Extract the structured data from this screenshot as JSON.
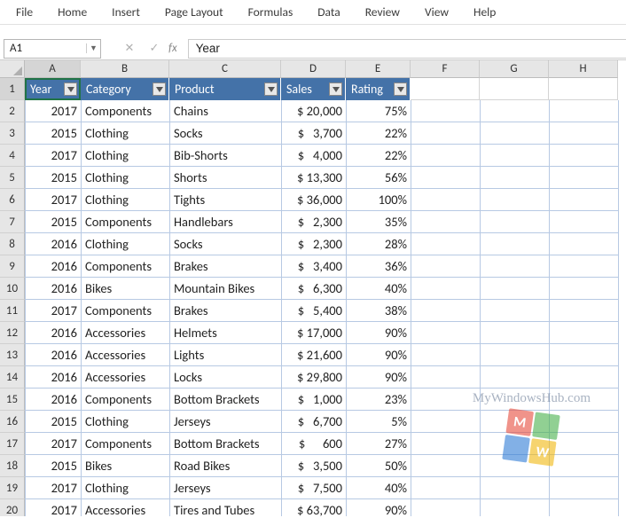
{
  "ribbon": [
    "File",
    "Home",
    "Insert",
    "Page Layout",
    "Formulas",
    "Data",
    "Review",
    "View",
    "Help"
  ],
  "namebox": "A1",
  "formula_value": "Year",
  "fx_label": "fx",
  "col_letters": [
    "A",
    "B",
    "C",
    "D",
    "E",
    "F",
    "G",
    "H"
  ],
  "row_count": 20,
  "table": {
    "headers": [
      "Year",
      "Category",
      "Product",
      "Sales",
      "Rating"
    ],
    "rows": [
      {
        "year": "2017",
        "category": "Components",
        "product": "Chains",
        "sales": "$ 20,000",
        "rating": "75%"
      },
      {
        "year": "2015",
        "category": "Clothing",
        "product": "Socks",
        "sales": "$   3,700",
        "rating": "22%"
      },
      {
        "year": "2017",
        "category": "Clothing",
        "product": "Bib-Shorts",
        "sales": "$   4,000",
        "rating": "22%"
      },
      {
        "year": "2015",
        "category": "Clothing",
        "product": "Shorts",
        "sales": "$ 13,300",
        "rating": "56%"
      },
      {
        "year": "2017",
        "category": "Clothing",
        "product": "Tights",
        "sales": "$ 36,000",
        "rating": "100%"
      },
      {
        "year": "2015",
        "category": "Components",
        "product": "Handlebars",
        "sales": "$   2,300",
        "rating": "35%"
      },
      {
        "year": "2016",
        "category": "Clothing",
        "product": "Socks",
        "sales": "$   2,300",
        "rating": "28%"
      },
      {
        "year": "2016",
        "category": "Components",
        "product": "Brakes",
        "sales": "$   3,400",
        "rating": "36%"
      },
      {
        "year": "2016",
        "category": "Bikes",
        "product": "Mountain Bikes",
        "sales": "$   6,300",
        "rating": "40%"
      },
      {
        "year": "2017",
        "category": "Components",
        "product": "Brakes",
        "sales": "$   5,400",
        "rating": "38%"
      },
      {
        "year": "2016",
        "category": "Accessories",
        "product": "Helmets",
        "sales": "$ 17,000",
        "rating": "90%"
      },
      {
        "year": "2016",
        "category": "Accessories",
        "product": "Lights",
        "sales": "$ 21,600",
        "rating": "90%"
      },
      {
        "year": "2016",
        "category": "Accessories",
        "product": "Locks",
        "sales": "$ 29,800",
        "rating": "90%"
      },
      {
        "year": "2016",
        "category": "Components",
        "product": "Bottom Brackets",
        "sales": "$   1,000",
        "rating": "23%"
      },
      {
        "year": "2015",
        "category": "Clothing",
        "product": "Jerseys",
        "sales": "$   6,700",
        "rating": "5%"
      },
      {
        "year": "2017",
        "category": "Components",
        "product": "Bottom Brackets",
        "sales": "$      600",
        "rating": "27%"
      },
      {
        "year": "2015",
        "category": "Bikes",
        "product": "Road Bikes",
        "sales": "$   3,500",
        "rating": "50%"
      },
      {
        "year": "2017",
        "category": "Clothing",
        "product": "Jerseys",
        "sales": "$   7,500",
        "rating": "40%"
      },
      {
        "year": "2017",
        "category": "Accessories",
        "product": "Tires and Tubes",
        "sales": "$ 63,700",
        "rating": "90%"
      }
    ]
  },
  "watermark": "MyWindowsHub.com",
  "watermark_letters": {
    "tl": "M",
    "br": "W"
  }
}
